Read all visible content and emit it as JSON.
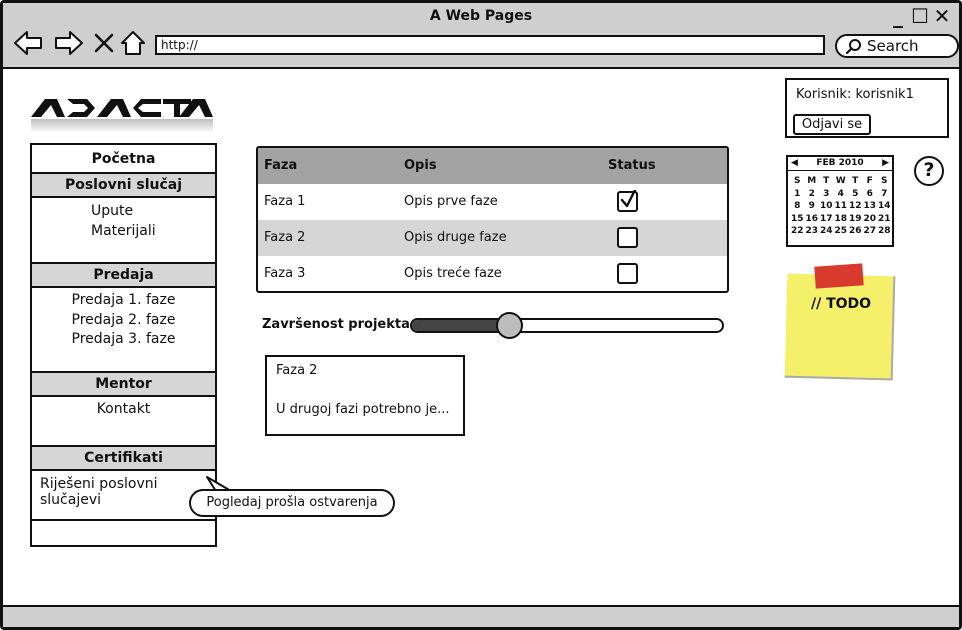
{
  "window": {
    "title": "A Web Pages",
    "minimize": "_",
    "maximize": "☐",
    "close": "✕"
  },
  "browser": {
    "address": "http://",
    "search_label": "Search"
  },
  "logo_text": "ADACTA",
  "user": {
    "label": "Korisnik: korisnik1",
    "logout_label": "Odjavi se"
  },
  "sidebar": {
    "home": "Početna",
    "section1": "Poslovni slučaj",
    "section1_items": [
      "Upute",
      "Materijali"
    ],
    "section2": "Predaja",
    "section2_items": [
      "Predaja 1. faze",
      "Predaja 2. faze",
      "Predaja 3. faze"
    ],
    "section3": "Mentor",
    "section3_items": [
      "Kontakt"
    ],
    "section4": "Certifikati",
    "section4_items": [
      "Riješeni poslovni slučajevi"
    ]
  },
  "tooltip": "Pogledaj prošla ostvarenja",
  "phases": {
    "columns": [
      "Faza",
      "Opis",
      "Status"
    ],
    "rows": [
      {
        "phase": "Faza 1",
        "desc": "Opis prve faze",
        "done": true
      },
      {
        "phase": "Faza 2",
        "desc": "Opis druge faze",
        "done": false
      },
      {
        "phase": "Faza 3",
        "desc": "Opis treće faze",
        "done": false
      }
    ]
  },
  "progress": {
    "label": "Završenost projekta",
    "fraction": 0.32
  },
  "note": {
    "title": "Faza 2",
    "text": "U drugoj fazi potrebno je..."
  },
  "calendar": {
    "month": "FEB 2010",
    "weekdays": [
      "S",
      "M",
      "T",
      "W",
      "T",
      "F",
      "S"
    ],
    "weeks": [
      [
        "1",
        "2",
        "3",
        "4",
        "5",
        "6",
        "7"
      ],
      [
        "8",
        "9",
        "10",
        "11",
        "12",
        "13",
        "14"
      ],
      [
        "15",
        "16",
        "17",
        "18",
        "19",
        "20",
        "21"
      ],
      [
        "22",
        "23",
        "24",
        "25",
        "26",
        "27",
        "28"
      ]
    ]
  },
  "help_label": "?",
  "todo_label": "// TODO",
  "colors": {
    "chrome": "#cfcfcf",
    "header_row": "#a3a3a3",
    "alt_row": "#d6d6d6",
    "sticky": "#f5f06a",
    "tape": "#d83a2e"
  }
}
